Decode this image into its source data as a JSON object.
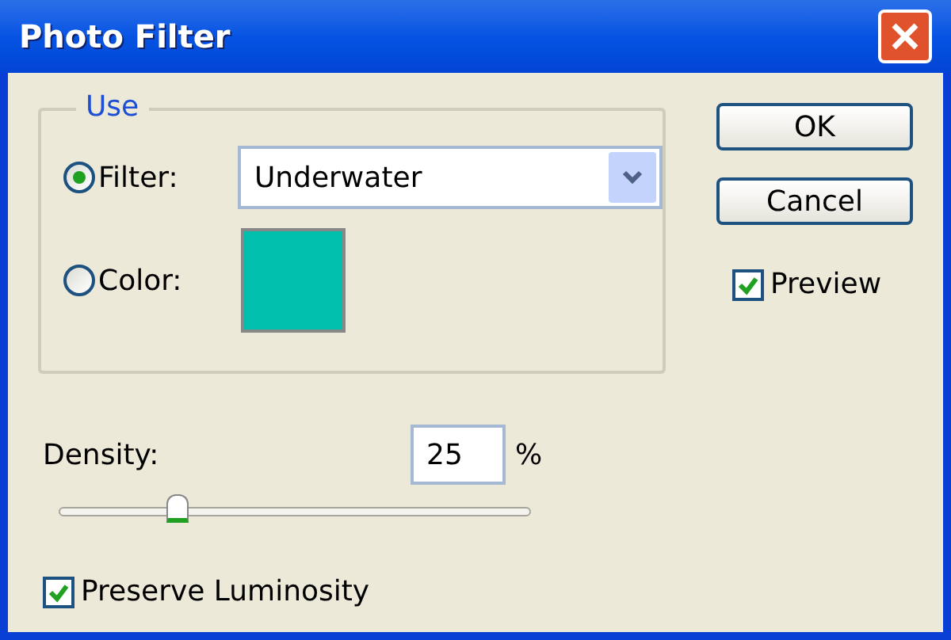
{
  "window": {
    "title": "Photo Filter"
  },
  "use_group": {
    "legend": "Use",
    "options": [
      {
        "kind": "filter",
        "label": "Filter:",
        "selected": true,
        "value": "Underwater"
      },
      {
        "kind": "color",
        "label": "Color:",
        "selected": false,
        "color": "#00bfad"
      }
    ]
  },
  "density": {
    "label": "Density:",
    "value": "25",
    "unit": "%",
    "level": 0.25
  },
  "preserve_luminosity": {
    "label": "Preserve Luminosity",
    "checked": true
  },
  "buttons": [
    "OK",
    "Cancel"
  ],
  "preview": {
    "label": "Preview",
    "checked": true
  }
}
